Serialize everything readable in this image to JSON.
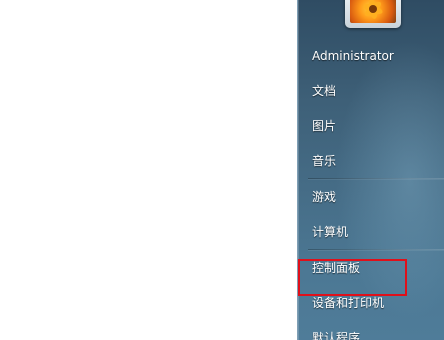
{
  "start_menu": {
    "user_name": "Administrator",
    "items": [
      {
        "label": "文档"
      },
      {
        "label": "图片"
      },
      {
        "label": "音乐"
      },
      {
        "label": "游戏"
      },
      {
        "label": "计算机"
      },
      {
        "label": "控制面板"
      },
      {
        "label": "设备和打印机"
      },
      {
        "label": "默认程序"
      }
    ],
    "highlighted_item": "控制面板",
    "highlight_color": "#e0101a"
  }
}
